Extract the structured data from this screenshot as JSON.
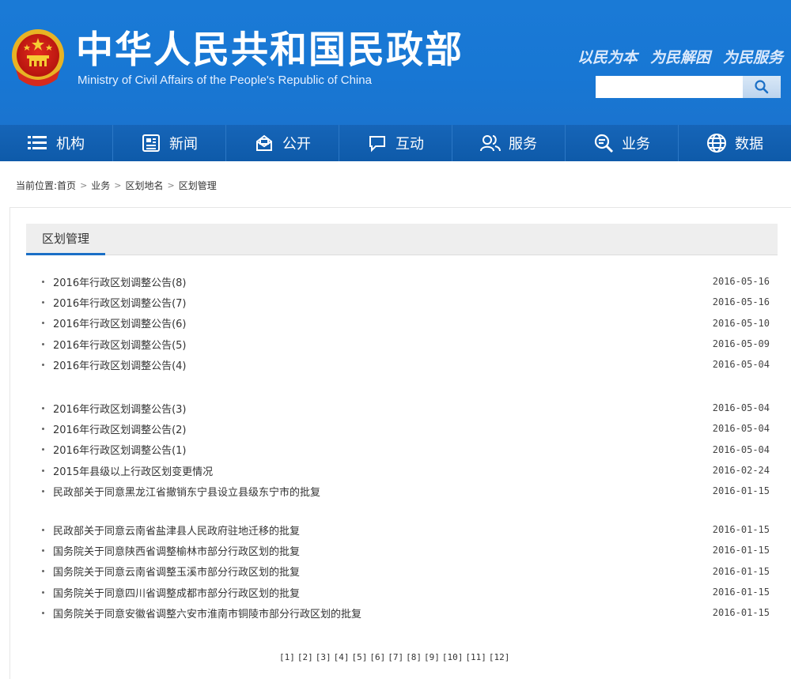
{
  "header": {
    "title_cn": "中华人民共和国民政部",
    "title_en": "Ministry of Civil Affairs of the People's Republic of China",
    "slogans": [
      "以民为本",
      "为民解困",
      "为民服务"
    ],
    "search": {
      "value": "",
      "placeholder": ""
    },
    "colors": {
      "banner": "#1877d4",
      "nav": "#0e5aa9",
      "accent": "#1a6fc6"
    }
  },
  "nav": {
    "items": [
      {
        "label": "机构",
        "icon": "list-icon"
      },
      {
        "label": "新闻",
        "icon": "newspaper-icon"
      },
      {
        "label": "公开",
        "icon": "open-mail-icon"
      },
      {
        "label": "互动",
        "icon": "chat-icon"
      },
      {
        "label": "服务",
        "icon": "users-icon"
      },
      {
        "label": "业务",
        "icon": "magnifier-icon"
      },
      {
        "label": "数据",
        "icon": "globe-icon"
      }
    ]
  },
  "breadcrumb": {
    "prefix": "当前位置:",
    "items": [
      "首页",
      "业务",
      "区划地名",
      "区划管理"
    ]
  },
  "section": {
    "title": "区划管理"
  },
  "news_groups": [
    [
      {
        "title": "2016年行政区划调整公告(8)",
        "date": "2016-05-16"
      },
      {
        "title": "2016年行政区划调整公告(7)",
        "date": "2016-05-16"
      },
      {
        "title": "2016年行政区划调整公告(6)",
        "date": "2016-05-10"
      },
      {
        "title": "2016年行政区划调整公告(5)",
        "date": "2016-05-09"
      },
      {
        "title": "2016年行政区划调整公告(4)",
        "date": "2016-05-04"
      }
    ],
    [
      {
        "title": "2016年行政区划调整公告(3)",
        "date": "2016-05-04"
      },
      {
        "title": "2016年行政区划调整公告(2)",
        "date": "2016-05-04"
      },
      {
        "title": "2016年行政区划调整公告(1)",
        "date": "2016-05-04"
      },
      {
        "title": "2015年县级以上行政区划变更情况",
        "date": "2016-02-24"
      },
      {
        "title": "民政部关于同意黑龙江省撤销东宁县设立县级东宁市的批复",
        "date": "2016-01-15"
      }
    ],
    [
      {
        "title": "民政部关于同意云南省盐津县人民政府驻地迁移的批复",
        "date": "2016-01-15"
      },
      {
        "title": "国务院关于同意陕西省调整榆林市部分行政区划的批复",
        "date": "2016-01-15"
      },
      {
        "title": "国务院关于同意云南省调整玉溪市部分行政区划的批复",
        "date": "2016-01-15"
      },
      {
        "title": "国务院关于同意四川省调整成都市部分行政区划的批复",
        "date": "2016-01-15"
      },
      {
        "title": "国务院关于同意安徽省调整六安市淮南市铜陵市部分行政区划的批复",
        "date": "2016-01-15"
      }
    ]
  ],
  "pagination": [
    "[1]",
    "[2]",
    "[3]",
    "[4]",
    "[5]",
    "[6]",
    "[7]",
    "[8]",
    "[9]",
    "[10]",
    "[11]",
    "[12]"
  ]
}
